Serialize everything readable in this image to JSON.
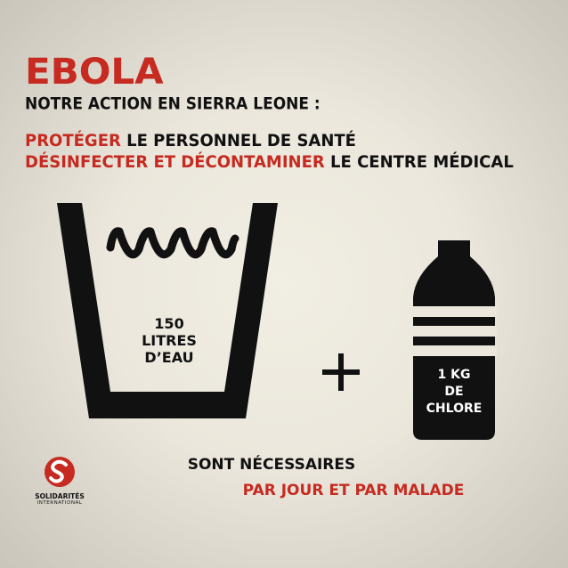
{
  "header": {
    "title": "EBOLA",
    "subtitle": "NOTRE ACTION EN SIERRA LEONE :"
  },
  "actions": {
    "line1_highlight": "PROTÉGER",
    "line1_rest": " LE PERSONNEL DE SANTÉ",
    "line2_highlight": "DÉSINFECTER ET DÉCONTAMINER",
    "line2_rest": " LE CENTRE MÉDICAL"
  },
  "water": {
    "amount": "150",
    "unit": "LITRES",
    "substance": "D’EAU"
  },
  "chlorine": {
    "amount": "1 KG",
    "connector": "DE",
    "substance": "CHLORE"
  },
  "footer": {
    "line1": "SONT NÉCESSAIRES",
    "line2": "PAR JOUR ET PAR MALADE"
  },
  "logo": {
    "name": "SOLIDARITÉS",
    "sub": "INTERNATIONAL"
  },
  "colors": {
    "accent": "#c62a20",
    "text": "#111111",
    "background": "#ebe7dc"
  },
  "icons": {
    "glass": "water-glass-icon",
    "plus": "plus-icon",
    "bottle": "chlorine-bottle-icon",
    "logo": "solidarites-logo-icon"
  }
}
